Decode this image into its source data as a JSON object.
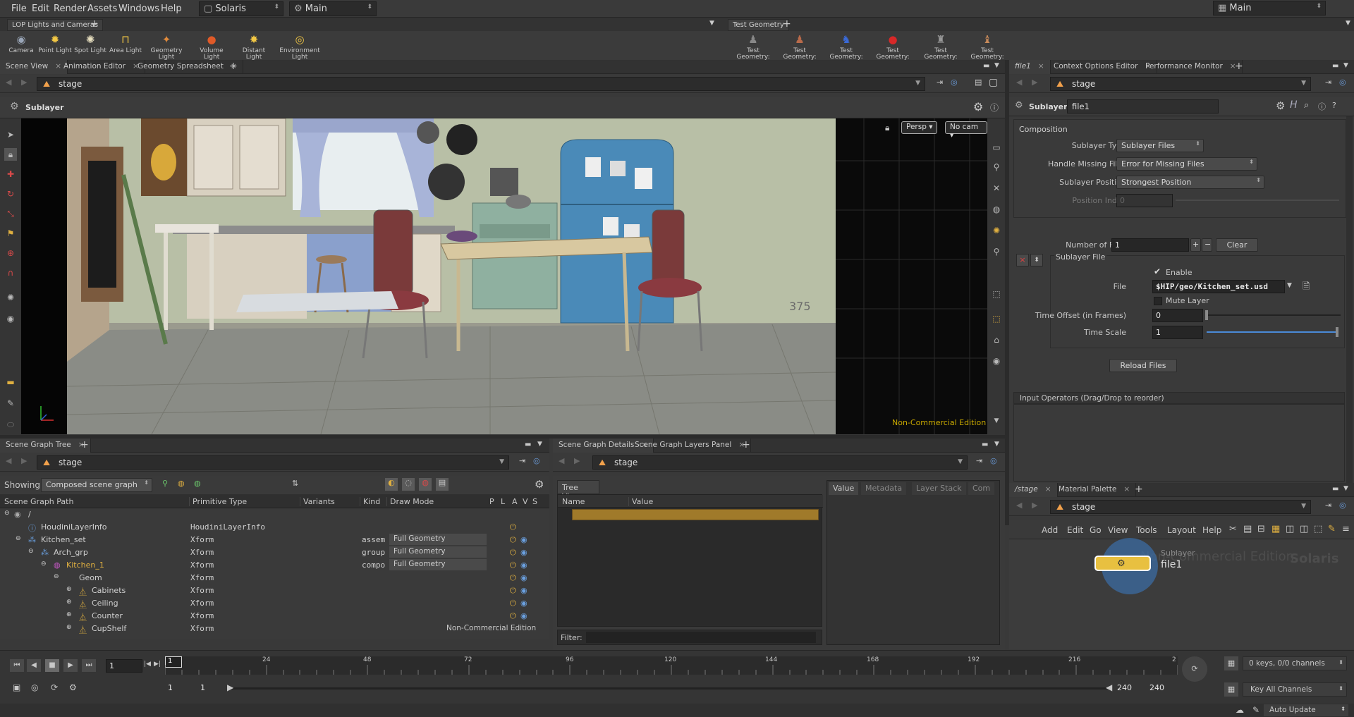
{
  "menu": {
    "items": [
      "File",
      "Edit",
      "Render",
      "Assets",
      "Windows",
      "Help"
    ],
    "desktop": "Solaris",
    "context": "Main",
    "right_desktop": "Main"
  },
  "shelf_tabs_left": [
    "LOP Lights and Cameras"
  ],
  "shelf_tabs_right": [
    "Test Geometry"
  ],
  "shelf_tools_left": [
    {
      "icon": "camera-icon",
      "label": "Camera"
    },
    {
      "icon": "point-light-icon",
      "label": "Point Light"
    },
    {
      "icon": "spot-light-icon",
      "label": "Spot Light"
    },
    {
      "icon": "area-light-icon",
      "label": "Area Light"
    },
    {
      "icon": "geometry-light-icon",
      "label": "Geometry Light"
    },
    {
      "icon": "volume-light-icon",
      "label": "Volume Light"
    },
    {
      "icon": "distant-light-icon",
      "label": "Distant Light"
    },
    {
      "icon": "environment-light-icon",
      "label": "Environment Light"
    }
  ],
  "shelf_tools_right": [
    {
      "label": "Test Geometry: C..."
    },
    {
      "label": "Test Geometry: P..."
    },
    {
      "label": "Test Geometry: R..."
    },
    {
      "label": "Test Geometry: S..."
    },
    {
      "label": "Test Geometry: S..."
    },
    {
      "label": "Test Geometry: T..."
    }
  ],
  "viewer": {
    "tabs": [
      "Scene View",
      "Animation Editor",
      "Geometry Spreadsheet"
    ],
    "path": "stage",
    "title": "Sublayer",
    "persp": "Persp",
    "cam": "No cam",
    "frame_overlay": "375",
    "watermark": "Non-Commercial Edition"
  },
  "param": {
    "tabs": [
      "file1",
      "Context Options Editor",
      "Performance Monitor"
    ],
    "path": "stage",
    "node_type": "Sublayer",
    "node_name": "file1",
    "composition_label": "Composition",
    "sublayer_type_label": "Sublayer Type",
    "sublayer_type": "Sublayer Files",
    "handle_missing_label": "Handle Missing Files",
    "handle_missing": "Error for Missing Files",
    "position_label": "Sublayer Position",
    "position": "Strongest Position",
    "position_index_label": "Position Index",
    "position_index": "0",
    "num_files_label": "Number of Files",
    "num_files": "1",
    "clear": "Clear",
    "sublayer_file_label": "Sublayer File",
    "enable": "Enable",
    "file_label": "File",
    "file": "$HIP/geo/Kitchen_set.usd",
    "mute": "Mute Layer",
    "time_offset_label": "Time Offset (in Frames)",
    "time_offset": "0",
    "time_scale_label": "Time Scale",
    "time_scale": "1",
    "reload": "Reload Files",
    "input_ops": "Input Operators (Drag/Drop to reorder)"
  },
  "scene_graph": {
    "tabs": [
      "Scene Graph Tree"
    ],
    "path": "stage",
    "showing_label": "Showing:",
    "showing": "Composed scene graph",
    "columns": [
      "Scene Graph Path",
      "Primitive Type",
      "Variants",
      "Kind",
      "Draw Mode",
      "P",
      "L",
      "A",
      "V",
      "S"
    ],
    "rows": [
      {
        "name": "/",
        "type": "",
        "kind": "",
        "draw": ""
      },
      {
        "name": "HoudiniLayerInfo",
        "type": "HoudiniLayerInfo",
        "kind": "",
        "draw": ""
      },
      {
        "name": "Kitchen_set",
        "type": "Xform",
        "kind": "assem",
        "draw": "Full Geometry"
      },
      {
        "name": "Arch_grp",
        "type": "Xform",
        "kind": "group",
        "draw": "Full Geometry"
      },
      {
        "name": "Kitchen_1",
        "type": "Xform",
        "kind": "compo",
        "draw": "Full Geometry"
      },
      {
        "name": "Geom",
        "type": "Xform",
        "kind": "",
        "draw": ""
      },
      {
        "name": "Cabinets",
        "type": "Xform",
        "kind": "",
        "draw": ""
      },
      {
        "name": "Ceiling",
        "type": "Xform",
        "kind": "",
        "draw": ""
      },
      {
        "name": "Counter",
        "type": "Xform",
        "kind": "",
        "draw": ""
      },
      {
        "name": "CupShelf",
        "type": "Xform",
        "kind": "",
        "draw": ""
      }
    ],
    "watermark": "Non-Commercial Edition"
  },
  "details": {
    "tabs": [
      "Scene Graph Details",
      "Scene Graph Layers Panel"
    ],
    "path": "stage",
    "tree_view": "Tree View",
    "col_name": "Name",
    "col_value": "Value",
    "right_tabs": [
      "Value",
      "Metadata",
      "Layer Stack",
      "Com"
    ],
    "filter": "Filter:"
  },
  "network": {
    "tabs": [
      "/stage",
      "Material Palette"
    ],
    "path": "stage",
    "menus": [
      "Add",
      "Edit",
      "Go",
      "View",
      "Tools",
      "Layout",
      "Help"
    ],
    "node_type": "Sublayer",
    "node_name": "file1",
    "bg_text1": "Non-Commercial Edition",
    "bg_text2": "Solaris"
  },
  "timeline": {
    "current_frame": "1",
    "frame_box": "1",
    "ticks": [
      "24",
      "48",
      "72",
      "96",
      "120",
      "144",
      "168",
      "192",
      "216",
      "2"
    ],
    "range_start": "1",
    "range_start2": "1",
    "range_end": "240",
    "range_end2": "240",
    "keys": "0 keys, 0/0 channels",
    "key_all": "Key All Channels"
  },
  "status": {
    "update": "Auto Update"
  }
}
